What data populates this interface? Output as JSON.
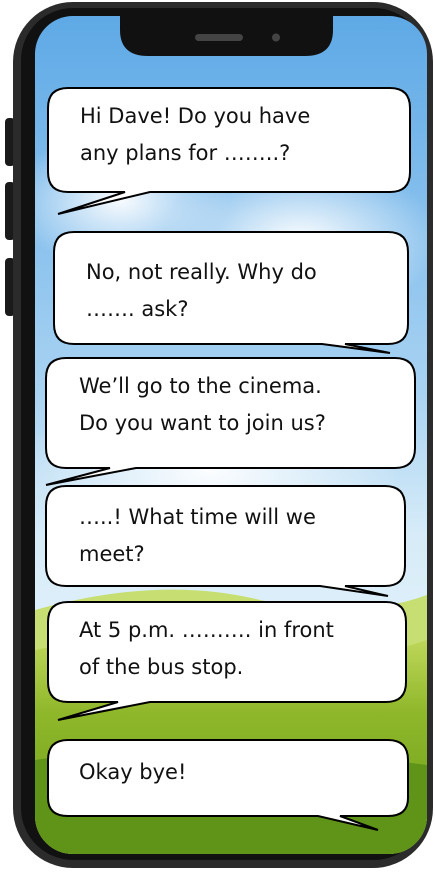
{
  "messages": [
    {
      "text": "Hi Dave! Do you have\nany plans for ……..?"
    },
    {
      "text": "No, not really. Why do\n……. ask?"
    },
    {
      "text": "We’ll go to the cinema.\nDo you want to join us?"
    },
    {
      "text": "…..! What time will we\nmeet?"
    },
    {
      "text": "At 5 p.m. ………. in front\nof the bus stop."
    },
    {
      "text": "Okay bye!"
    }
  ]
}
